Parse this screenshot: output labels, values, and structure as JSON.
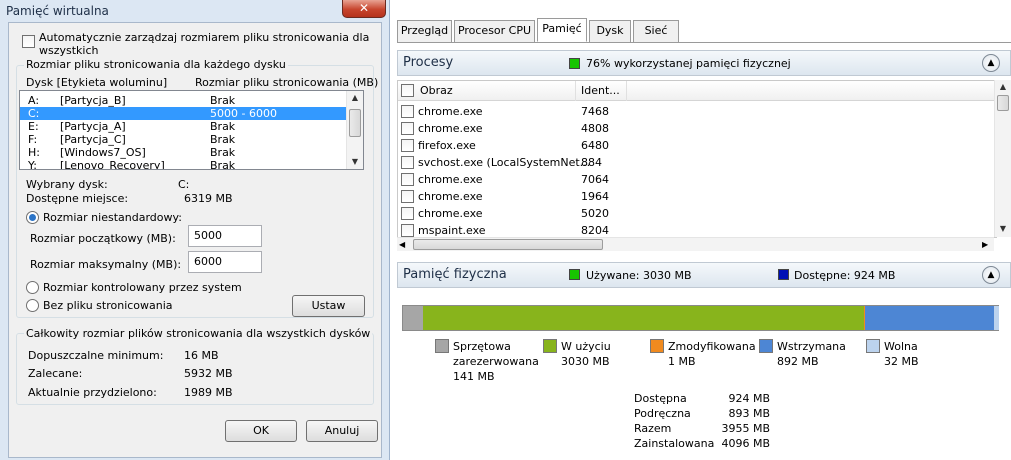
{
  "dialog": {
    "title": "Pamięć wirtualna",
    "close_symbol": "✕",
    "auto_manage_label_line1": "Automatycznie zarządzaj rozmiarem pliku stronicowania dla wszystkich",
    "auto_manage_label_line2": "dysków",
    "per_drive_group": "Rozmiar pliku stronicowania dla każdego dysku",
    "col_drive": "Dysk [Etykieta woluminu]",
    "col_size": "Rozmiar pliku stronicowania (MB)",
    "drives": [
      {
        "letter": "A:",
        "label": "[Partycja_B]",
        "size": "Brak"
      },
      {
        "letter": "C:",
        "label": "",
        "size": "5000 - 6000"
      },
      {
        "letter": "E:",
        "label": "[Partycja_A]",
        "size": "Brak"
      },
      {
        "letter": "F:",
        "label": "[Partycja_C]",
        "size": "Brak"
      },
      {
        "letter": "H:",
        "label": "[Windows7_OS]",
        "size": "Brak"
      },
      {
        "letter": "Y:",
        "label": "[Lenovo_Recovery]",
        "size": "Brak"
      }
    ],
    "selected_drive_label": "Wybrany dysk:",
    "selected_drive_value": "C:",
    "free_space_label": "Dostępne miejsce:",
    "free_space_value": "6319 MB",
    "custom_size_label": "Rozmiar niestandardowy:",
    "initial_size_label": "Rozmiar początkowy (MB):",
    "initial_size_value": "5000",
    "max_size_label": "Rozmiar maksymalny (MB):",
    "max_size_value": "6000",
    "system_managed_label": "Rozmiar kontrolowany przez system",
    "no_paging_label": "Bez pliku stronicowania",
    "set_button": "Ustaw",
    "total_group": "Całkowity rozmiar plików stronicowania dla wszystkich dysków",
    "min_label": "Dopuszczalne minimum:",
    "min_value": "16 MB",
    "recommended_label": "Zalecane:",
    "recommended_value": "5932 MB",
    "allocated_label": "Aktualnie przydzielono:",
    "allocated_value": "1989 MB",
    "ok_button": "OK",
    "cancel_button": "Anuluj"
  },
  "monitor": {
    "tabs": [
      "Przegląd",
      "Procesor CPU",
      "Pamięć",
      "Dysk",
      "Sieć"
    ],
    "active_tab": 2,
    "processes_title": "Procesy",
    "processes_status": "76% wykorzystanej pamięci fizycznej",
    "col_image": "Obraz",
    "col_id": "Ident...",
    "processes": [
      {
        "name": "chrome.exe",
        "pid": "7468"
      },
      {
        "name": "chrome.exe",
        "pid": "4808"
      },
      {
        "name": "firefox.exe",
        "pid": "6480"
      },
      {
        "name": "svchost.exe (LocalSystemNet...",
        "pid": "884"
      },
      {
        "name": "chrome.exe",
        "pid": "7064"
      },
      {
        "name": "chrome.exe",
        "pid": "1964"
      },
      {
        "name": "chrome.exe",
        "pid": "5020"
      },
      {
        "name": "mspaint.exe",
        "pid": "8204"
      }
    ],
    "physical_title": "Pamięć fizyczna",
    "used_label": "Używane: 3030 MB",
    "available_label": "Dostępne: 924 MB",
    "bar": {
      "total_mb": 4096,
      "hardware_reserved_mb": 141,
      "in_use_mb": 3030,
      "modified_mb": 1,
      "standby_mb": 892,
      "free_mb": 32
    },
    "legend": [
      {
        "name_line1": "Sprzętowa",
        "name_line2": "zarezerwowana",
        "value": "141 MB",
        "color": "#a6a6a6"
      },
      {
        "name_line1": "W użyciu",
        "name_line2": "",
        "value": "3030 MB",
        "color": "#88b41c"
      },
      {
        "name_line1": "Zmodyfikowana",
        "name_line2": "",
        "value": "1 MB",
        "color": "#f08a1f"
      },
      {
        "name_line1": "Wstrzymana",
        "name_line2": "",
        "value": "892 MB",
        "color": "#4d86d4"
      },
      {
        "name_line1": "Wolna",
        "name_line2": "",
        "value": "32 MB",
        "color": "#bcd3ee"
      }
    ],
    "stats": [
      {
        "label": "Dostępna",
        "value": "924 MB"
      },
      {
        "label": "Podręczna",
        "value": "893 MB"
      },
      {
        "label": "Razem",
        "value": "3955 MB"
      },
      {
        "label": "Zainstalowana",
        "value": "4096 MB"
      }
    ],
    "colors": {
      "green_indicator": "#17c400",
      "blue_indicator": "#0010b5"
    }
  }
}
